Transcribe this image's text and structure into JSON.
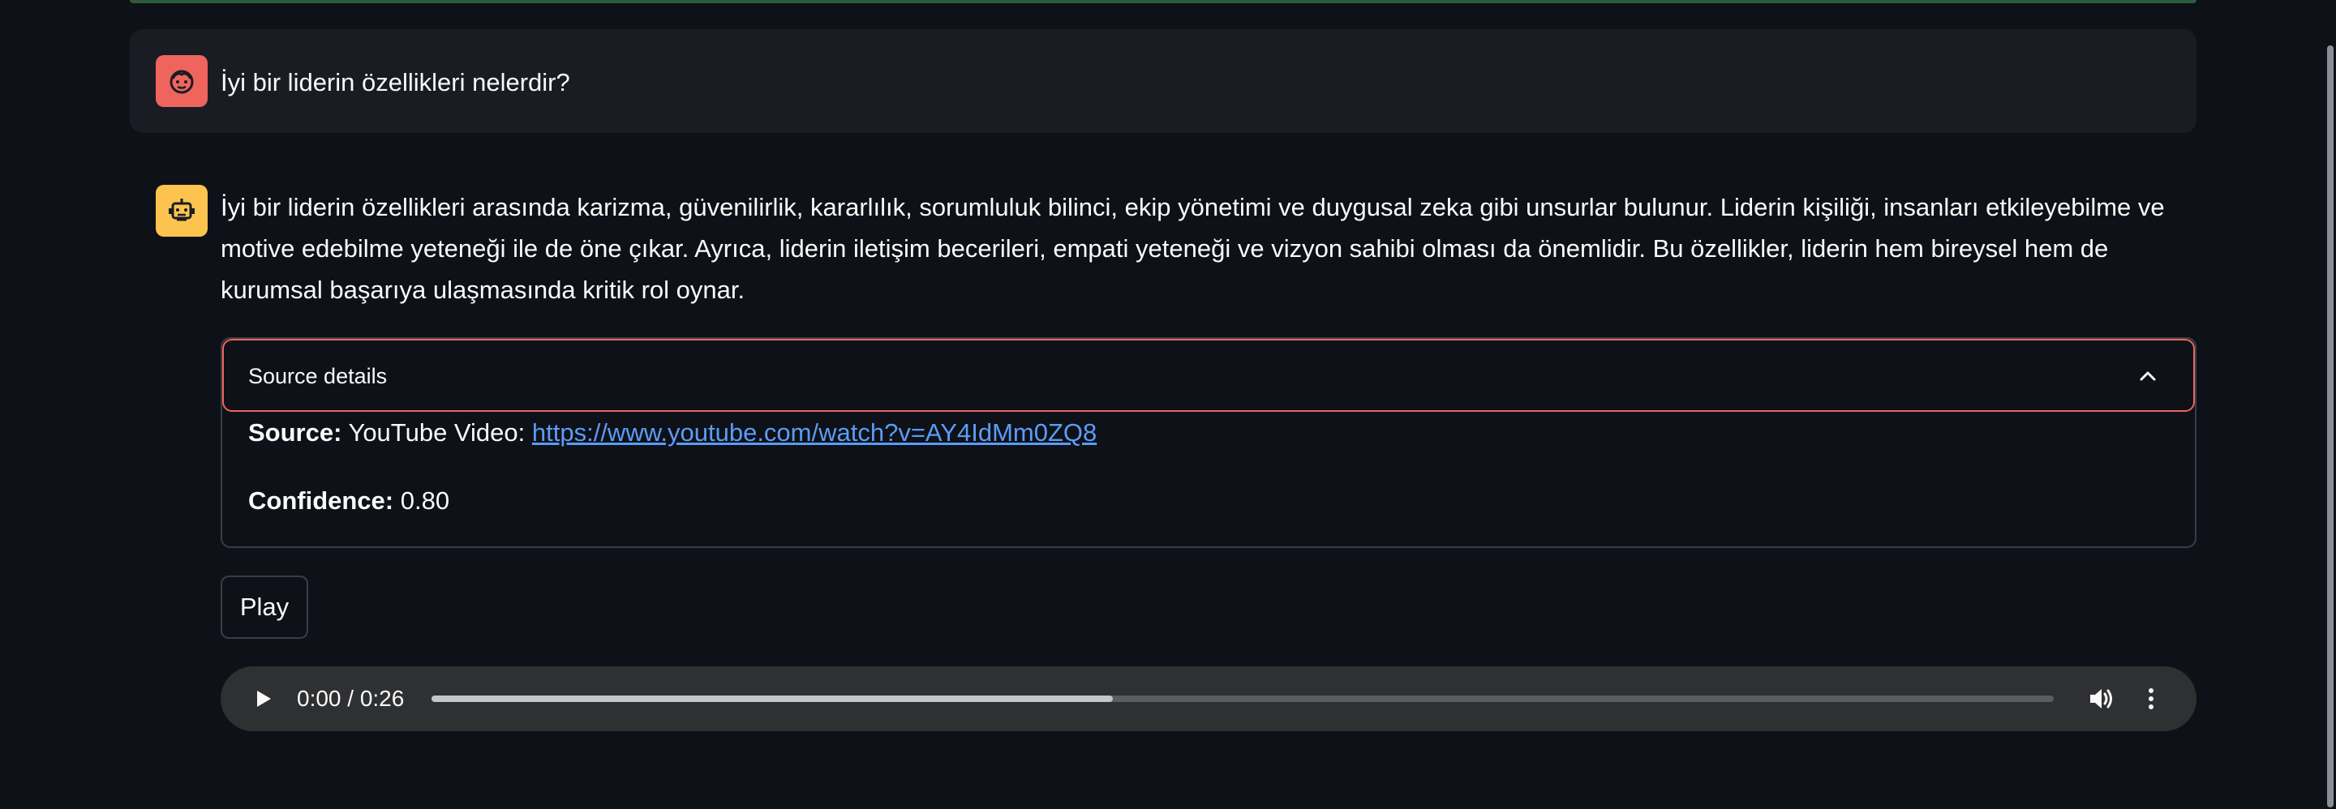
{
  "user_message": {
    "text": "İyi bir liderin özellikleri nelerdir?",
    "avatar_icon": "user-face-icon",
    "avatar_color": "#f0645e"
  },
  "assistant_message": {
    "text": "İyi bir liderin özellikleri arasında karizma, güvenilirlik, kararlılık, sorumluluk bilinci, ekip yönetimi ve duygusal zeka gibi unsurlar bulunur. Liderin kişiliği, insanları etkileyebilme ve motive edebilme yeteneği ile de öne çıkar. Ayrıca, liderin iletişim becerileri, empati yeteneği ve vizyon sahibi olması da önemlidir. Bu özellikler, liderin hem bireysel hem de kurumsal başarıya ulaşmasında kritik rol oynar.",
    "avatar_icon": "robot-icon",
    "avatar_color": "#fcc34f"
  },
  "source_details": {
    "title": "Source details",
    "expanded": true,
    "source_label": "Source:",
    "source_type": "YouTube Video:",
    "source_url": "https://www.youtube.com/watch?v=AY4IdMm0ZQ8",
    "confidence_label": "Confidence:",
    "confidence_value": "0.80"
  },
  "play_button": {
    "label": "Play"
  },
  "audio_player": {
    "time": "0:00 / 0:26",
    "buffered_fraction": 0.42,
    "play_icon": "play-icon",
    "volume_icon": "volume-icon",
    "menu_icon": "more-vertical-icon"
  }
}
